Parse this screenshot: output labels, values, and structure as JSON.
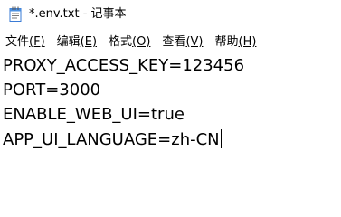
{
  "window": {
    "title": "*.env.txt - 记事本",
    "icon": "notepad-icon"
  },
  "menu": [
    {
      "label": "文件",
      "accel": "(F)"
    },
    {
      "label": "编辑",
      "accel": "(E)"
    },
    {
      "label": "格式",
      "accel": "(O)"
    },
    {
      "label": "查看",
      "accel": "(V)"
    },
    {
      "label": "帮助",
      "accel": "(H)"
    }
  ],
  "editor": {
    "lines": [
      "PROXY_ACCESS_KEY=123456",
      "PORT=3000",
      "ENABLE_WEB_UI=true",
      "APP_UI_LANGUAGE=zh-CN"
    ]
  }
}
